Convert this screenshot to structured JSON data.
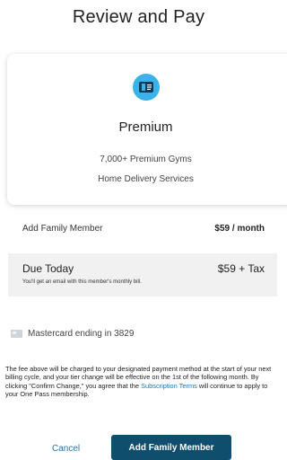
{
  "page": {
    "title": "Review and Pay"
  },
  "plan": {
    "icon": "membership-card-icon",
    "name": "Premium",
    "features": [
      "7,000+ Premium Gyms",
      "Home Delivery Services"
    ]
  },
  "line_item": {
    "label": "Add Family Member",
    "price": "$59 / month"
  },
  "due_today": {
    "label": "Due Today",
    "price": "$59 + Tax",
    "note": "You'll get an email with this member's monthly bill."
  },
  "payment": {
    "icon": "credit-card-icon",
    "label": "Mastercard ending in 3829"
  },
  "disclaimer": {
    "text_before": "The fee above will be charged to your designated payment method at the start of your next billing cycle, and your tier change will be effective on the 1st of the following month. By clicking \"Confirm Change,\" you agree that the ",
    "link": "Subscription Terms",
    "text_after": " will continue to apply to your One Pass membership."
  },
  "actions": {
    "cancel": "Cancel",
    "confirm": "Add Family Member"
  },
  "colors": {
    "accent": "#1a73b5",
    "primary_button": "#0f4e6d",
    "icon_bg": "#3cb3e8"
  }
}
